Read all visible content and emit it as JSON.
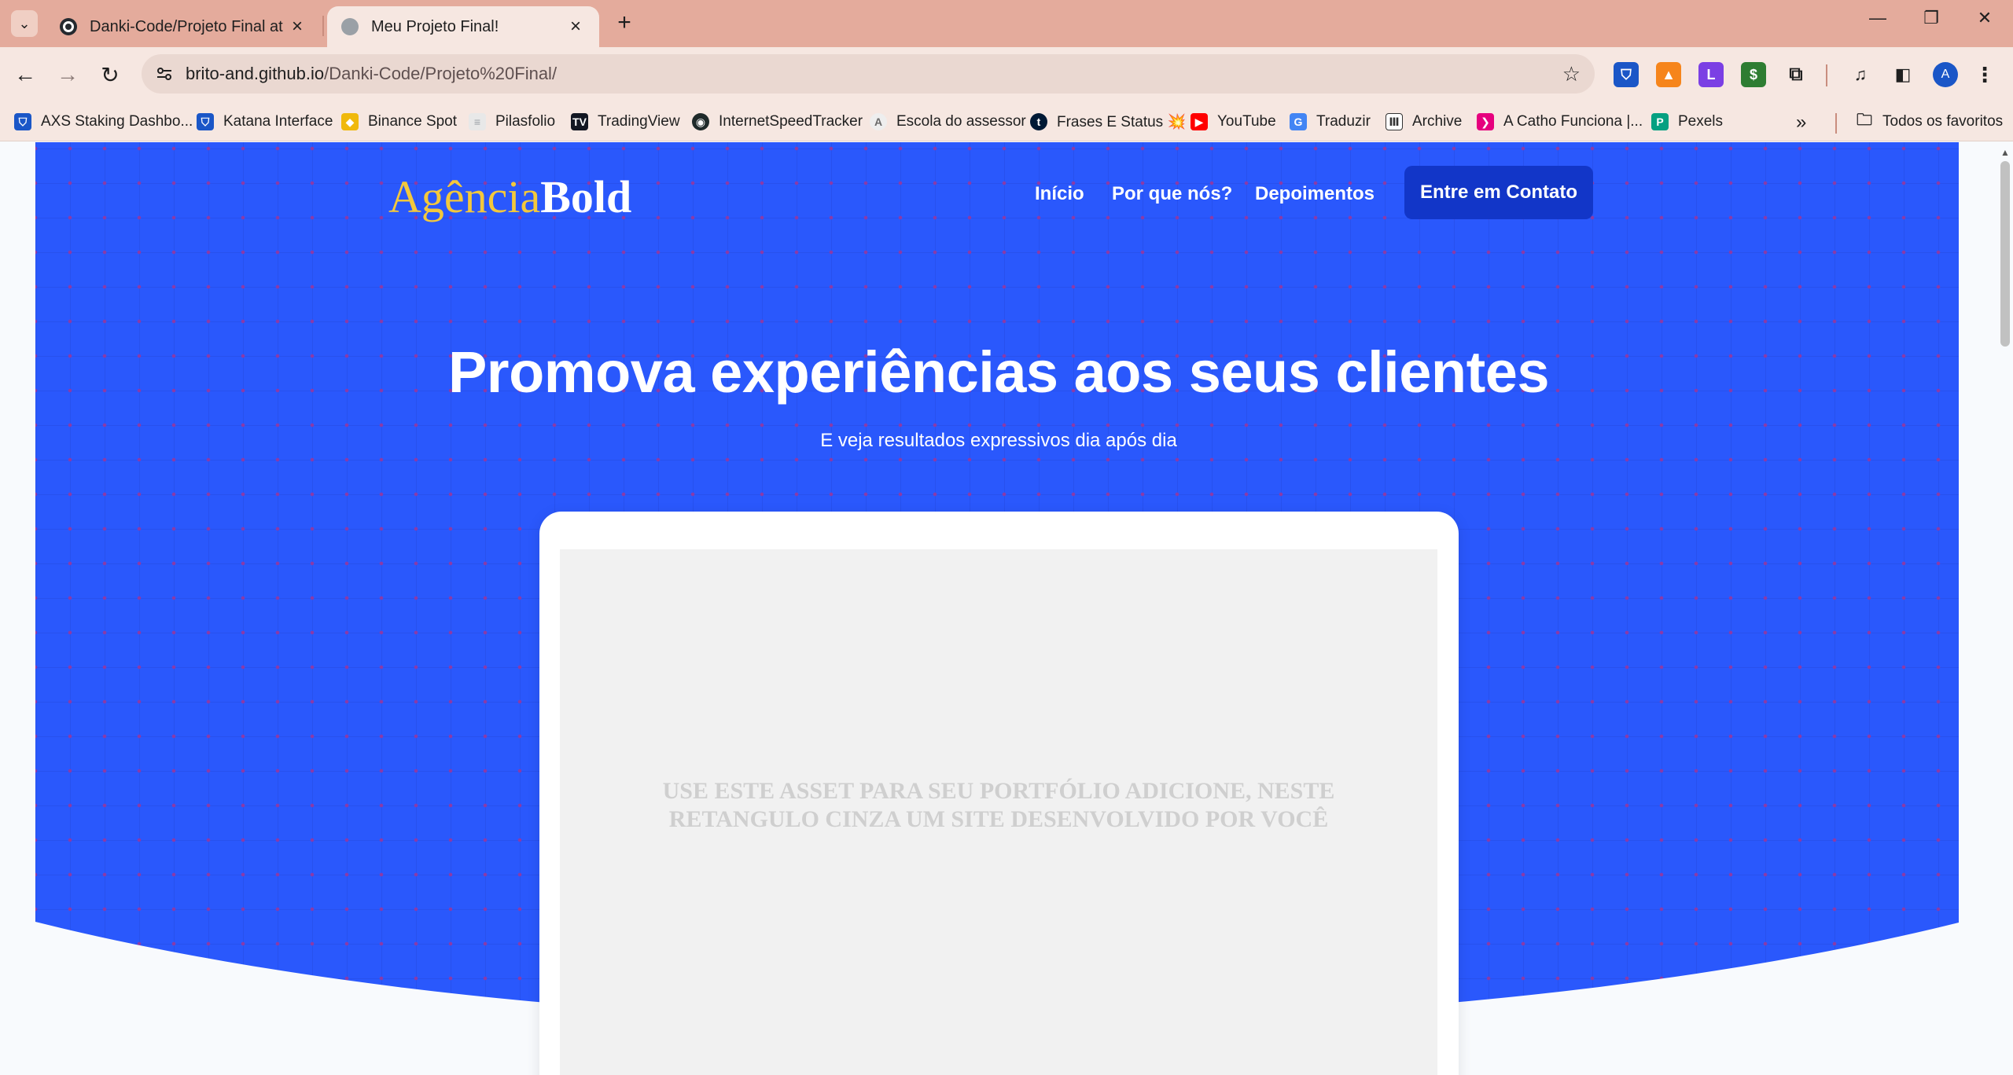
{
  "browser": {
    "tabs": [
      {
        "title": "Danki-Code/Projeto Final at ma",
        "active": false
      },
      {
        "title": "Meu Projeto Final!",
        "active": true
      }
    ],
    "url_host": "brito-and.github.io",
    "url_path": "/Danki-Code/Projeto%20Final/",
    "avatar_letter": "A",
    "bookmarks": [
      {
        "label": "AXS Staking Dashbo...",
        "icon": "shield-icon",
        "color": "#1a56c7"
      },
      {
        "label": "Katana Interface",
        "icon": "shield-icon",
        "color": "#1a56c7"
      },
      {
        "label": "Binance Spot",
        "icon": "binance-icon",
        "color": "#f0b90b"
      },
      {
        "label": "Pilasfolio",
        "icon": "page-icon",
        "color": "#9aa0a6"
      },
      {
        "label": "TradingView",
        "icon": "tradingview-icon",
        "color": "#131722"
      },
      {
        "label": "InternetSpeedTracker",
        "icon": "speed-icon",
        "color": "#1f2a2a"
      },
      {
        "label": "Escola do assessor",
        "icon": "escola-icon",
        "color": "#6b6b6b"
      },
      {
        "label": "Frases E Status 💥",
        "icon": "tumblr-icon",
        "color": "#001935"
      },
      {
        "label": "YouTube",
        "icon": "youtube-icon",
        "color": "#ff0000"
      },
      {
        "label": "Traduzir",
        "icon": "translate-icon",
        "color": "#4285f4"
      },
      {
        "label": "Archive",
        "icon": "archive-icon",
        "color": "#333333"
      },
      {
        "label": "A Catho Funciona |...",
        "icon": "catho-icon",
        "color": "#e6007e"
      },
      {
        "label": "Pexels",
        "icon": "pexels-icon",
        "color": "#05a081"
      }
    ],
    "all_bookmarks_label": "Todos os favoritos"
  },
  "page": {
    "logo_part1": "Agência",
    "logo_part2": "Bold",
    "nav": [
      "Início",
      "Por que nós?",
      "Depoimentos"
    ],
    "cta_label": "Entre em Contato",
    "headline": "Promova experiências aos seus clientes",
    "subheadline": "E veja resultados expressivos dia após dia",
    "mockup_text": "USE ESTE ASSET PARA SEU PORTFÓLIO ADICIONE, NESTE RETANGULO CINZA UM SITE DESENVOLVIDO POR VOCÊ",
    "colors": {
      "hero": "#2a58fc",
      "logo_accent": "#f3c83c",
      "cta": "#1236c8"
    }
  }
}
